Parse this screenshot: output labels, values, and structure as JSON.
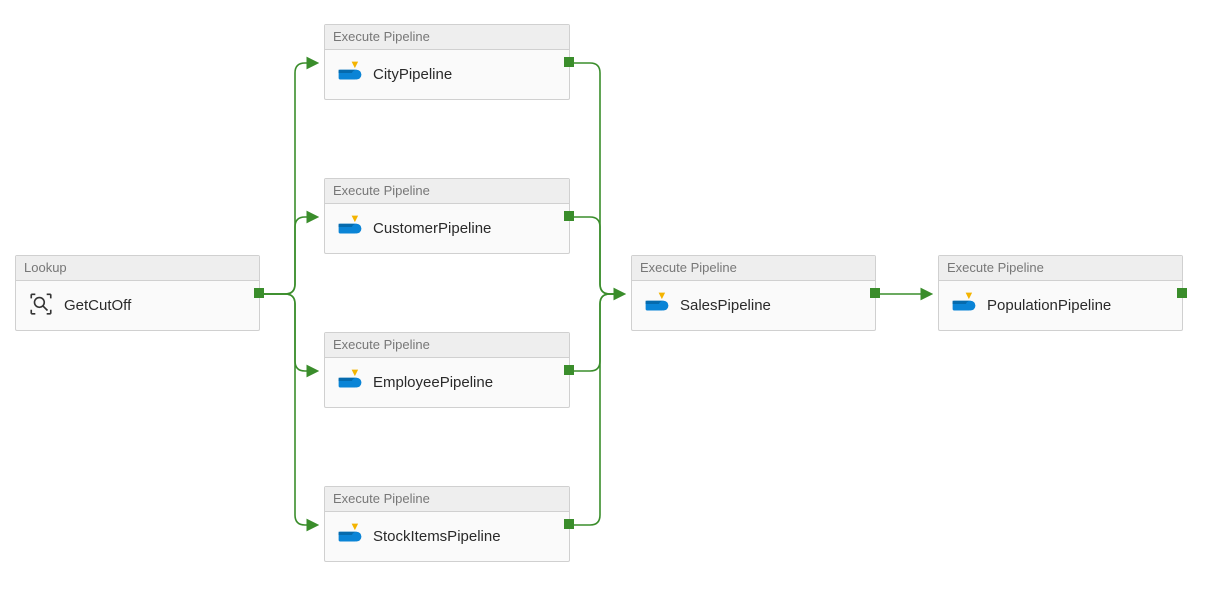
{
  "activities": {
    "lookup": {
      "type_label": "Lookup",
      "name": "GetCutOff",
      "icon": "search-icon"
    },
    "city": {
      "type_label": "Execute Pipeline",
      "name": "CityPipeline",
      "icon": "pipeline-icon"
    },
    "customer": {
      "type_label": "Execute Pipeline",
      "name": "CustomerPipeline",
      "icon": "pipeline-icon"
    },
    "employee": {
      "type_label": "Execute Pipeline",
      "name": "EmployeePipeline",
      "icon": "pipeline-icon"
    },
    "stockitems": {
      "type_label": "Execute Pipeline",
      "name": "StockItemsPipeline",
      "icon": "pipeline-icon"
    },
    "sales": {
      "type_label": "Execute Pipeline",
      "name": "SalesPipeline",
      "icon": "pipeline-icon"
    },
    "population": {
      "type_label": "Execute Pipeline",
      "name": "PopulationPipeline",
      "icon": "pipeline-icon"
    }
  },
  "colors": {
    "connector": "#3a8d2b",
    "border": "#d0d0d0",
    "header_bg": "#eeeeee",
    "body_bg": "#fafafa"
  }
}
